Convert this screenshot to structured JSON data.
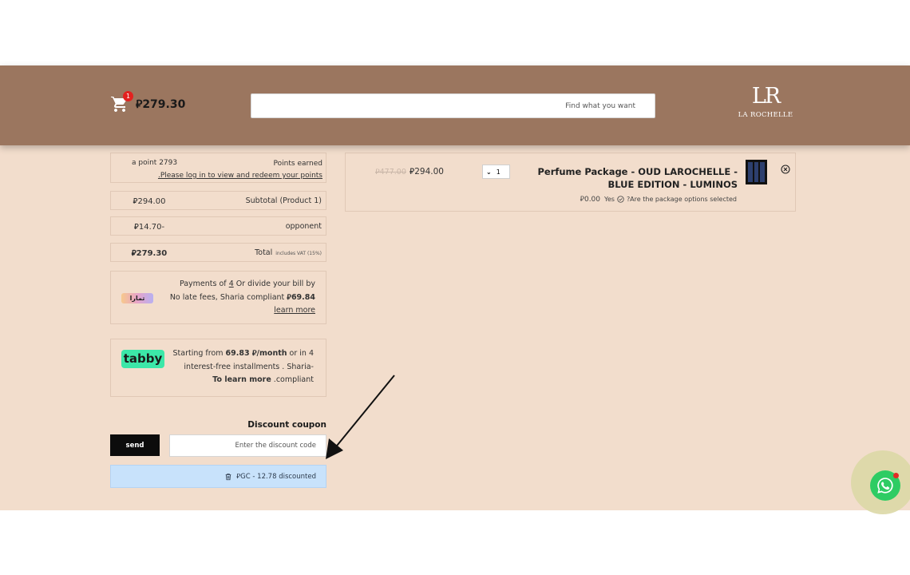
{
  "header": {
    "cart_count": "1",
    "cart_total": "⃁279.30",
    "search_placeholder": "Find what you want",
    "logo_mark": "LR",
    "logo_text": "LA ROCHELLE"
  },
  "summary": {
    "points_value": "a point 2793",
    "points_label": "Points earned",
    "points_login": ".Please log in to view and redeem your points",
    "subtotal_value": "⃁294.00",
    "subtotal_label": "Subtotal (Product 1)",
    "opponent_value": "⃁14.70-",
    "opponent_label": "opponent",
    "total_value": "⃁279.30",
    "total_label": "Total",
    "vat_note": "includes VAT (15%)"
  },
  "tamara": {
    "logo": "تمارا",
    "line1_prefix": "Payments of ",
    "line1_num": "4",
    "line1_suffix": " Or divide your bill by",
    "line2_prefix": "No late fees, Sharia compliant ",
    "line2_amount": "⃁69.84",
    "learn_more": "learn more"
  },
  "tabby": {
    "logo": "tabby",
    "line1_prefix": "Starting from ",
    "line1_amount": "69.83 ⃁/month",
    "line1_suffix": " or in 4",
    "line2": "interest-free installments . Sharia-",
    "line3_bold": "To learn more",
    "line3_suffix": " .compliant"
  },
  "coupon": {
    "label": "Discount coupon",
    "send": "send",
    "placeholder": "Enter the discount code",
    "applied": "⃁GC - 12.78 discounted"
  },
  "product": {
    "old_price": "⃁477.00",
    "price": "⃁294.00",
    "qty": "1",
    "name": "Perfume Package - OUD LAROCHELLE - BLUE EDITION - LUMINOS",
    "opt_amount": "⃁0.00",
    "opt_yes": "Yes",
    "opt_question": "?Are the package options selected"
  },
  "colors": {
    "header_bg": "#9b765f",
    "content_bg": "#f2ddcc",
    "tabby_green": "#3ce7a8",
    "whatsapp_green": "#2ecc63",
    "applied_bg": "#c8e2fb"
  }
}
